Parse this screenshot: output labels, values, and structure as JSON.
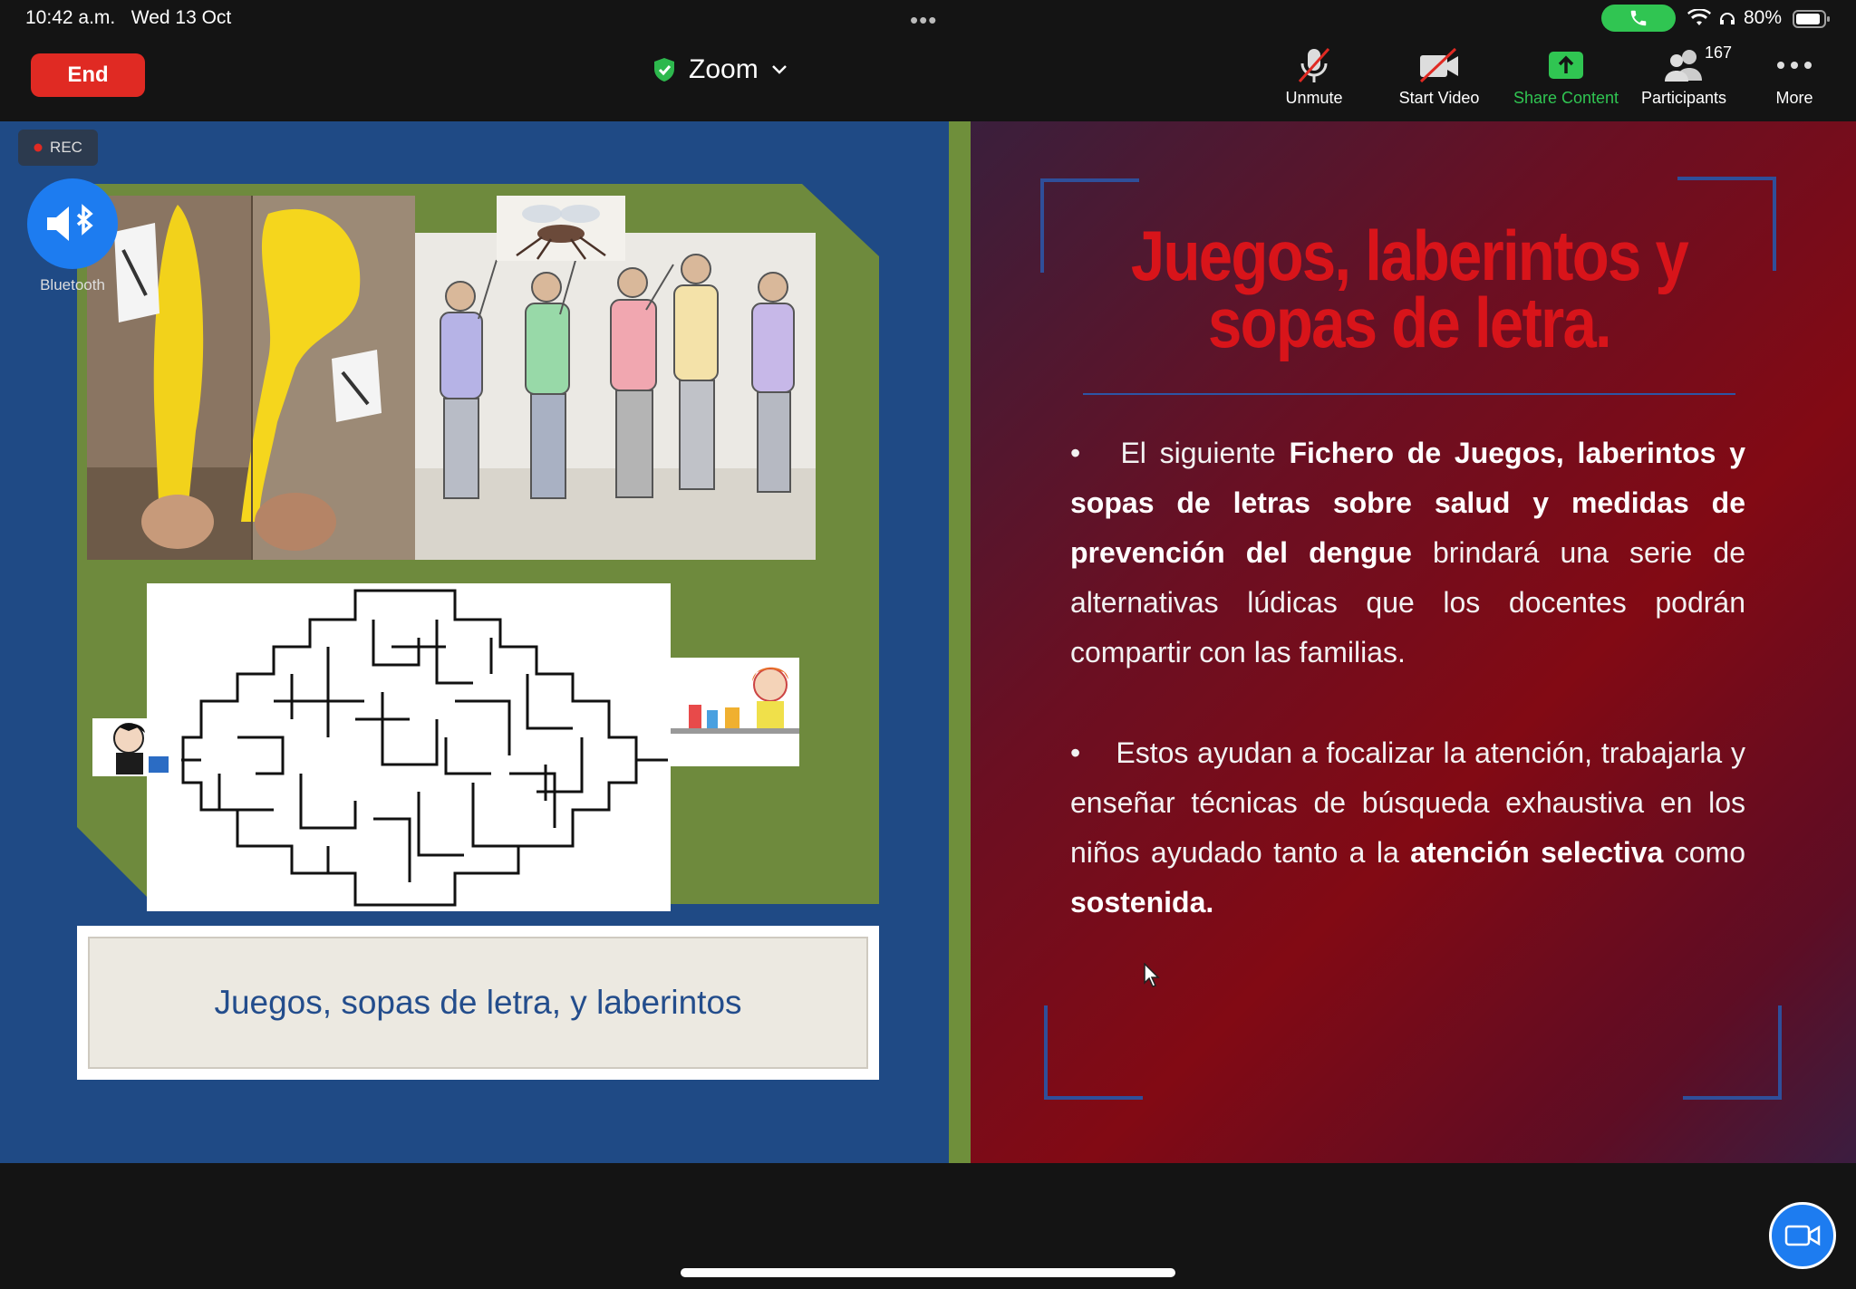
{
  "status_bar": {
    "time": "10:42 a.m.",
    "date": "Wed 13 Oct",
    "battery_pct": "80%"
  },
  "toolbar": {
    "end_label": "End",
    "meeting_title": "Zoom",
    "unmute_label": "Unmute",
    "start_video_label": "Start Video",
    "share_label": "Share Content",
    "participants_label": "Participants",
    "participants_count": "167",
    "more_label": "More"
  },
  "overlay": {
    "rec_label": "REC",
    "bluetooth_label": "Bluetooth"
  },
  "slide": {
    "caption": "Juegos, sopas de letra, y laberintos",
    "title_line1": "Juegos, laberintos y",
    "title_line2": "sopas de letra.",
    "para1": {
      "t1": "El siguiente ",
      "b1": "Fichero de Juegos, laberintos y sopas de letras sobre salud y  medidas de prevención del dengue",
      "t2": " brindará una serie de alternativas lúdicas  que los docentes podrán compartir con las familias."
    },
    "para2": {
      "t1": "Estos ayudan a focalizar la atención, trabajarla y enseñar técnicas de búsqueda exhaustiva en los niños ayudado tanto a la ",
      "b1": "atención selectiva",
      "t2": " como ",
      "b2": "sostenida."
    }
  },
  "colors": {
    "end_red": "#e02a23",
    "share_green": "#30c552",
    "zoom_blue": "#1d7cf0",
    "slide_title_red": "#d8141a",
    "caption_blue": "#234d8c"
  }
}
